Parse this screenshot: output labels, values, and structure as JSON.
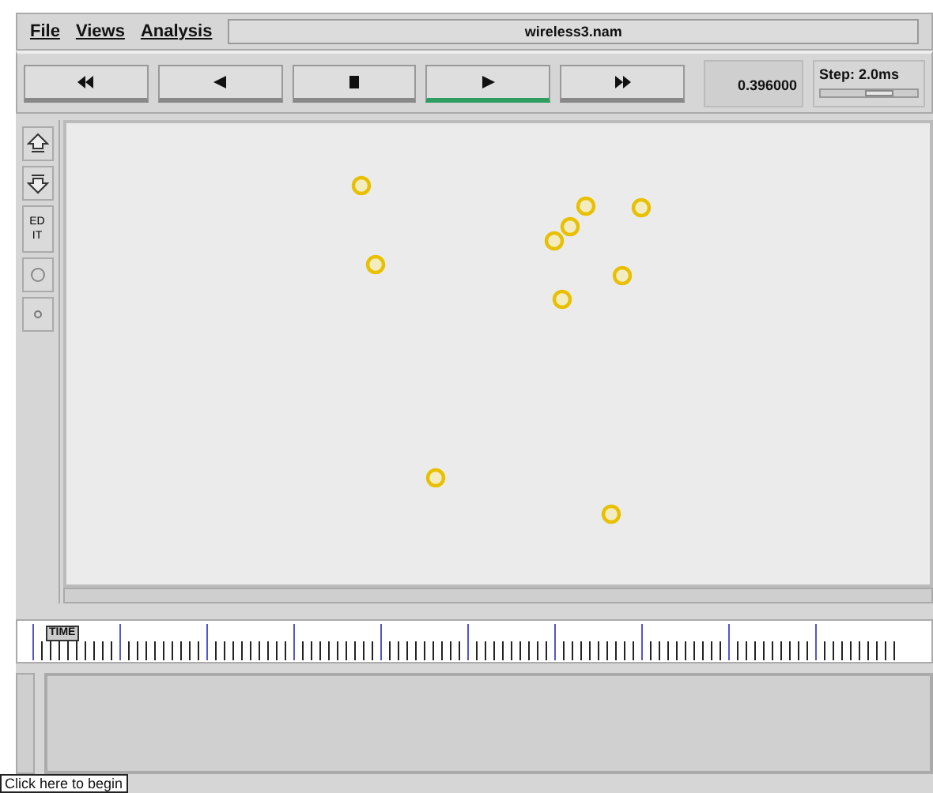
{
  "menu": [
    {
      "label": "File"
    },
    {
      "label": "Views"
    },
    {
      "label": "Analysis"
    }
  ],
  "file_name": "wireless3.nam",
  "playback_buttons": [
    {
      "kind": "fast-rewind",
      "selected": false
    },
    {
      "kind": "back",
      "selected": false
    },
    {
      "kind": "stop",
      "selected": false
    },
    {
      "kind": "play",
      "selected": true
    },
    {
      "kind": "fast-forward",
      "selected": false
    }
  ],
  "time": "0.396000",
  "step": {
    "label": "Step: 2.0ms",
    "level": 0.6
  },
  "tools": [
    {
      "kind": "zoom-in"
    },
    {
      "kind": "zoom-out"
    },
    {
      "kind": "edit",
      "label": "ED IT"
    },
    {
      "kind": "circle"
    },
    {
      "kind": "dot"
    }
  ],
  "timeline": {
    "label": "TIME"
  },
  "tooltip": "Click here to begin"
}
